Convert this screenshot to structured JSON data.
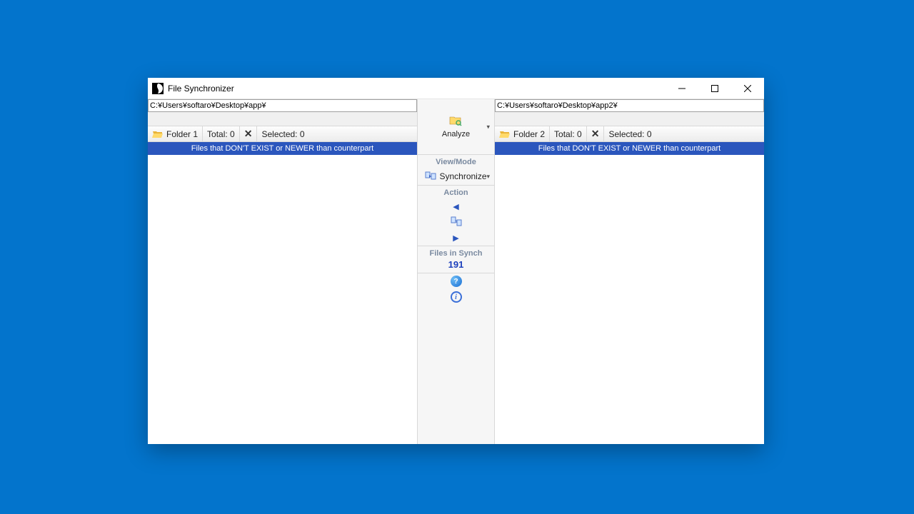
{
  "window": {
    "title": "File Synchronizer"
  },
  "left": {
    "path": "C:¥Users¥softaro¥Desktop¥app¥",
    "folder_label": "Folder 1",
    "total_label": "Total: 0",
    "selected_label": "Selected: 0",
    "header": "Files that DON'T EXIST or NEWER than counterpart"
  },
  "right": {
    "path": "C:¥Users¥softaro¥Desktop¥app2¥",
    "folder_label": "Folder 2",
    "total_label": "Total: 0",
    "selected_label": "Selected: 0",
    "header": "Files that DON'T EXIST or NEWER than counterpart"
  },
  "center": {
    "analyze": "Analyze",
    "viewmode_label": "View/Mode",
    "synchronize": "Synchronize",
    "action_label": "Action",
    "files_in_synch_label": "Files in Synch",
    "files_in_synch_count": "191"
  }
}
